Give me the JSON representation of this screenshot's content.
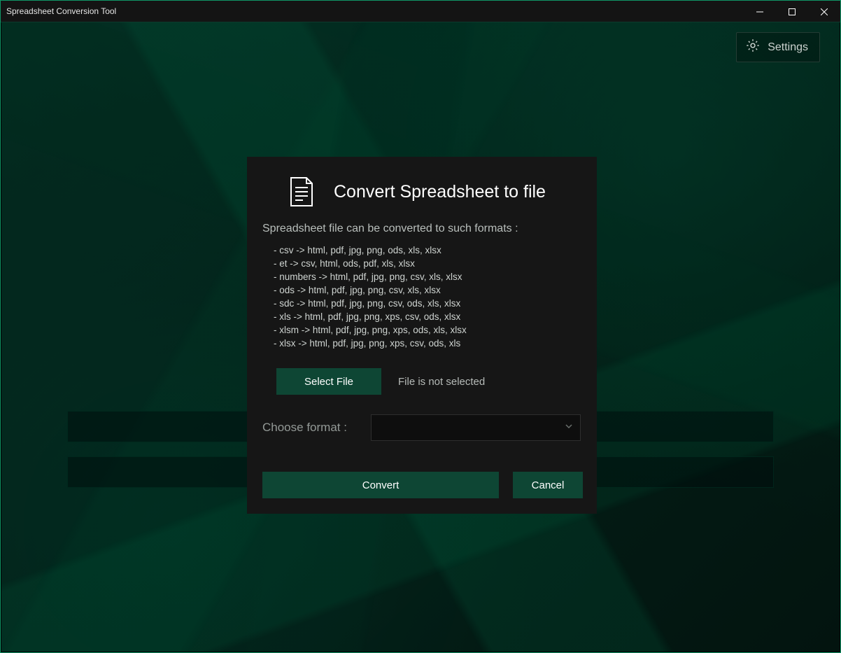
{
  "window": {
    "title": "Spreadsheet Conversion Tool"
  },
  "header": {
    "settings_label": "Settings"
  },
  "dialog": {
    "title": "Convert Spreadsheet to file",
    "subtitle": "Spreadsheet file can be converted to such formats :",
    "formats": [
      "csv -> html, pdf, jpg, png, ods, xls, xlsx",
      "et -> csv, html, ods, pdf, xls, xlsx",
      "numbers -> html, pdf, jpg, png, csv, xls, xlsx",
      "ods -> html, pdf, jpg, png, csv, xls, xlsx",
      "sdc -> html, pdf, jpg, png, csv, ods, xls, xlsx",
      "xls -> html, pdf, jpg, png, xps, csv, ods, xlsx",
      "xlsm -> html, pdf, jpg, png, xps, ods, xls, xlsx",
      "xlsx -> html, pdf, jpg, png, xps, csv, ods, xls"
    ],
    "select_file_label": "Select File",
    "file_status": "File is not selected",
    "choose_format_label": "Choose format :",
    "convert_label": "Convert",
    "cancel_label": "Cancel"
  }
}
